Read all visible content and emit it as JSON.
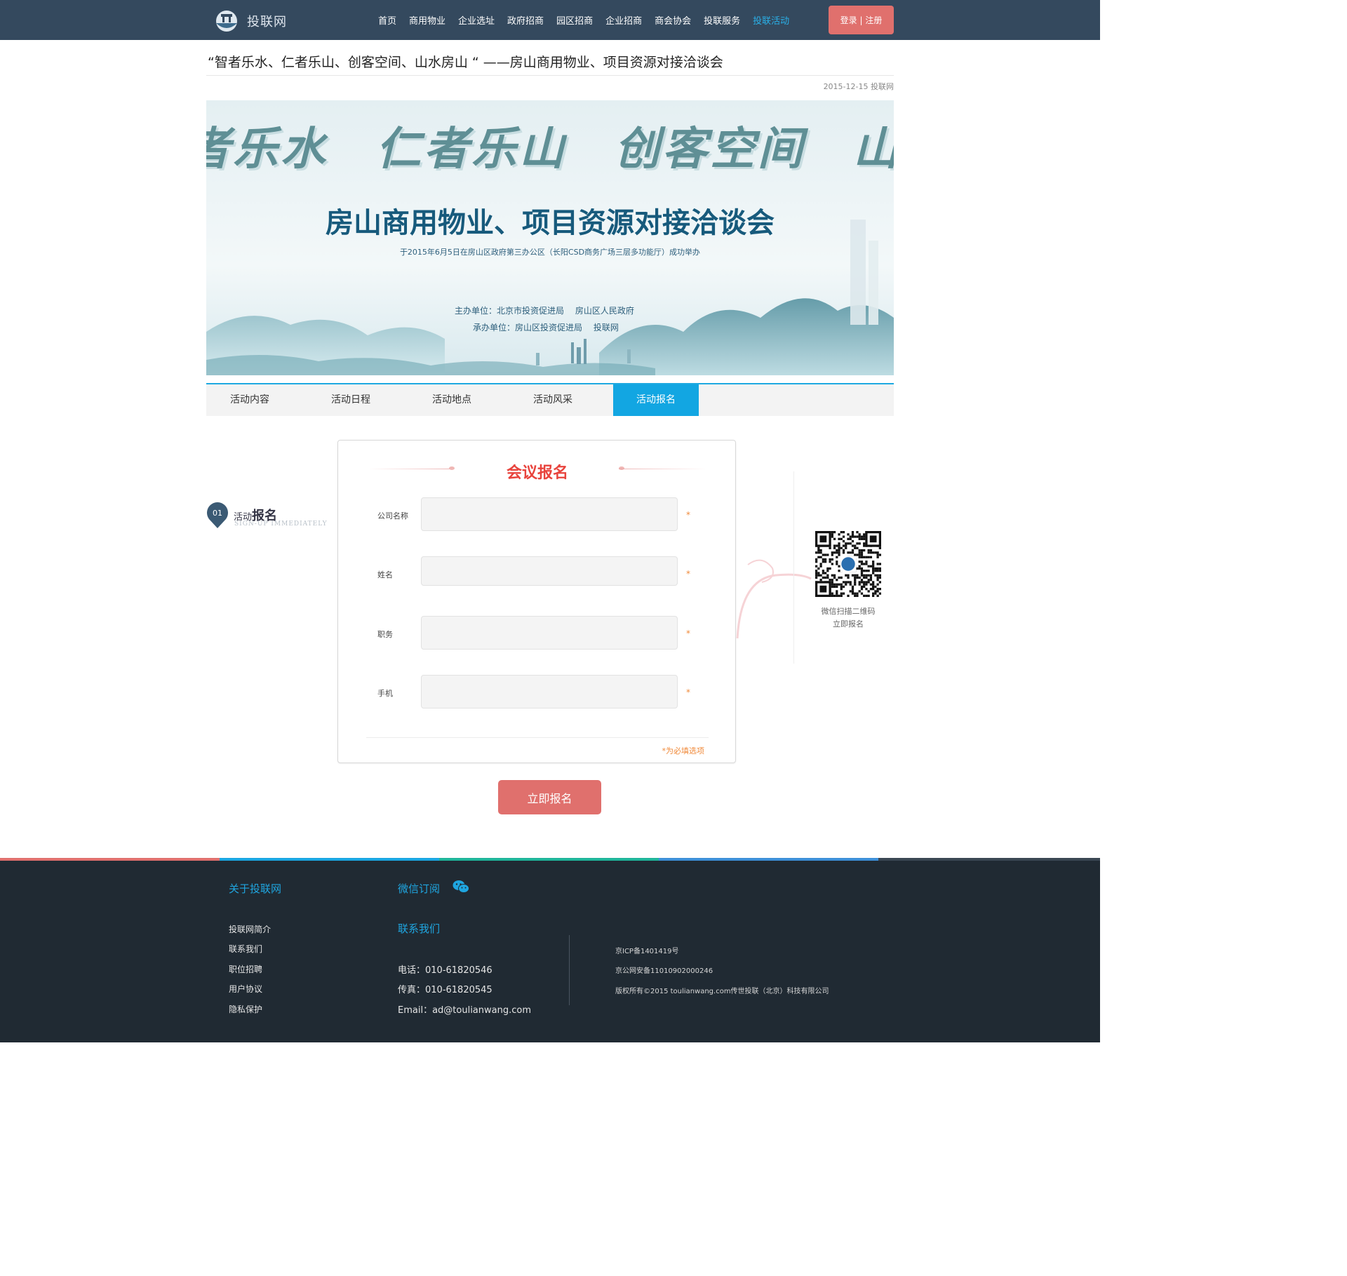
{
  "header": {
    "logo_text": "投联网",
    "nav": [
      {
        "label": "首页",
        "active": false
      },
      {
        "label": "商用物业",
        "active": false
      },
      {
        "label": "企业选址",
        "active": false
      },
      {
        "label": "政府招商",
        "active": false
      },
      {
        "label": "园区招商",
        "active": false
      },
      {
        "label": "企业招商",
        "active": false
      },
      {
        "label": "商会协会",
        "active": false
      },
      {
        "label": "投联服务",
        "active": false
      },
      {
        "label": "投联活动",
        "active": true
      }
    ],
    "login_label": "登录 | 注册"
  },
  "article": {
    "title": "“智者乐水、仁者乐山、创客空间、山水房山 “ ——房山商用物业、项目资源对接洽谈会",
    "date": "2015-12-15",
    "source": "投联网"
  },
  "banner": {
    "calligraphy": "者乐水　仁者乐山　创客空间　山水房",
    "title": "房山商用物业、项目资源对接洽谈会",
    "subtitle": "于2015年6月5日在房山区政府第三办公区（长阳CSD商务广场三层多功能厅）成功举办",
    "host": "主办单位：北京市投资促进局　 房山区人民政府",
    "organizer": "承办单位：房山区投资促进局　 投联网"
  },
  "tabs": [
    {
      "label": "活动内容",
      "active": false
    },
    {
      "label": "活动日程",
      "active": false
    },
    {
      "label": "活动地点",
      "active": false
    },
    {
      "label": "活动风采",
      "active": false
    },
    {
      "label": "活动报名",
      "active": true
    }
  ],
  "section": {
    "number": "01",
    "title_prefix": "活动",
    "title_main": "报名",
    "title_en": "SIGN-UP IMMEDIATELY"
  },
  "form": {
    "heading": "会议报名",
    "fields": [
      {
        "label": "公司名称",
        "value": "",
        "required_mark": "*"
      },
      {
        "label": "姓名",
        "value": "",
        "required_mark": "*"
      },
      {
        "label": "职务",
        "value": "",
        "required_mark": "*"
      },
      {
        "label": "手机",
        "value": "",
        "required_mark": "*"
      }
    ],
    "note": "*为必填选项",
    "submit_label": "立即报名"
  },
  "qr": {
    "caption_line1": "微信扫描二维码",
    "caption_line2": "立即报名"
  },
  "footer": {
    "about_title": "关于投联网",
    "links": [
      "投联网简介",
      "联系我们",
      "职位招聘",
      "用户协议",
      "隐私保护"
    ],
    "wechat_title": "微信订阅",
    "contact_title": "联系我们",
    "phone": "电话：010-61820546",
    "fax": "传真：010-61820545",
    "email": "Email：ad@toulianwang.com",
    "icp": "京ICP备1401419号",
    "police": "京公网安备11010902000246",
    "copyright": "版权所有©2015 toulianwang.com传世投联（北京）科技有限公司"
  },
  "colors": {
    "header_bg": "#34495e",
    "accent_blue": "#12a6e2",
    "button_red": "#e0706d",
    "heading_red": "#e8433c",
    "footer_bg": "#202a33"
  }
}
